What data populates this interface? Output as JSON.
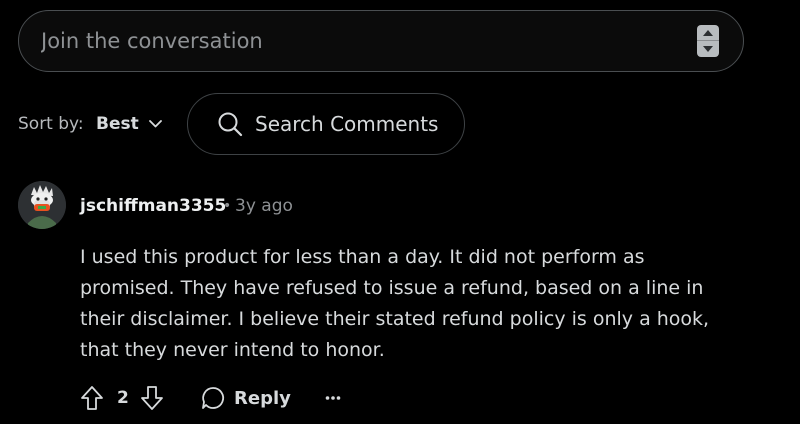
{
  "compose": {
    "placeholder": "Join the conversation"
  },
  "sort": {
    "label": "Sort by:",
    "value": "Best"
  },
  "search": {
    "label": "Search Comments"
  },
  "comment": {
    "username": "jschiffman3355",
    "separator": "•",
    "age": "3y ago",
    "body": "I used this product for less than a day. It did not perform as promised. They have refused to issue a refund, based on a line in their disclaimer. I believe their stated refund policy is only a hook, that they never intend to honor.",
    "vote_count": "2",
    "reply_label": "Reply",
    "more_label": "···"
  }
}
